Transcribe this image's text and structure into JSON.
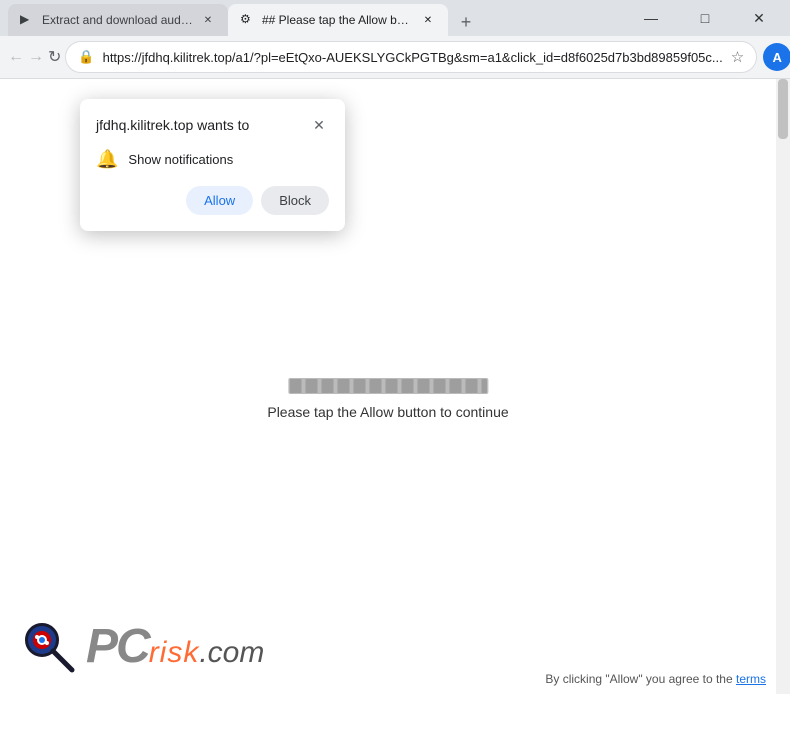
{
  "browser": {
    "tabs": [
      {
        "id": "tab1",
        "title": "Extract and download audio an...",
        "active": false,
        "favicon": "▶"
      },
      {
        "id": "tab2",
        "title": "## Please tap the Allow button...",
        "active": true,
        "favicon": "⚙"
      }
    ],
    "new_tab_label": "+",
    "address_bar": {
      "url": "https://jfdhq.kilitrek.top/a1/?pl=eEtQxo-AUEKSLYGCkPGTBg&sm=a1&click_id=d8f6025d7b3bd89859f05c...",
      "lock_icon": "🔒"
    },
    "nav": {
      "back_label": "←",
      "forward_label": "→",
      "refresh_label": "↻"
    },
    "window_controls": {
      "minimize": "—",
      "maximize": "□",
      "close": "✕"
    }
  },
  "notification_popup": {
    "title": "jfdhq.kilitrek.top wants to",
    "close_label": "✕",
    "notification_icon": "🔔",
    "notification_text": "Show notifications",
    "allow_label": "Allow",
    "block_label": "Block"
  },
  "page": {
    "progress_text": "Please tap the Allow button to continue",
    "bottom_text": "By clicking \"Allow\" you agree to the",
    "terms_link": "terms"
  },
  "logo": {
    "pc_text": "PC",
    "risk_text": "risk",
    "dotcom_text": ".com"
  }
}
